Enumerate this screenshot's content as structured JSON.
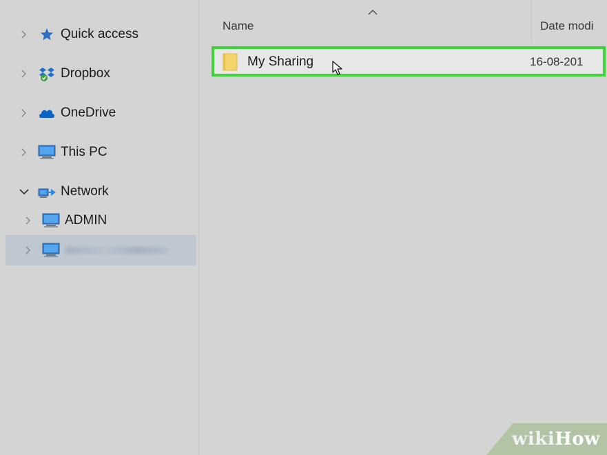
{
  "sidebar": {
    "items": [
      {
        "label": "Quick access",
        "icon": "star-icon",
        "expanded": false
      },
      {
        "label": "Dropbox",
        "icon": "dropbox-icon",
        "expanded": false
      },
      {
        "label": "OneDrive",
        "icon": "onedrive-cloud-icon",
        "expanded": false
      },
      {
        "label": "This PC",
        "icon": "computer-icon",
        "expanded": false
      },
      {
        "label": "Network",
        "icon": "network-icon",
        "expanded": true
      }
    ],
    "network_children": [
      {
        "label": "ADMIN",
        "icon": "computer-icon"
      },
      {
        "label": "",
        "icon": "computer-icon",
        "blurred": true,
        "selected": true
      }
    ]
  },
  "columns": {
    "name": "Name",
    "date": "Date modi"
  },
  "files": [
    {
      "name": "My Sharing",
      "date": "16-08-201",
      "icon": "folder-icon",
      "highlighted": true
    }
  ],
  "watermark": {
    "part1": "wiki",
    "part2": "How"
  },
  "colors": {
    "highlight_border": "#3fd53a",
    "selection_bg": "#bfc7d0",
    "background": "#d4d4d4"
  }
}
